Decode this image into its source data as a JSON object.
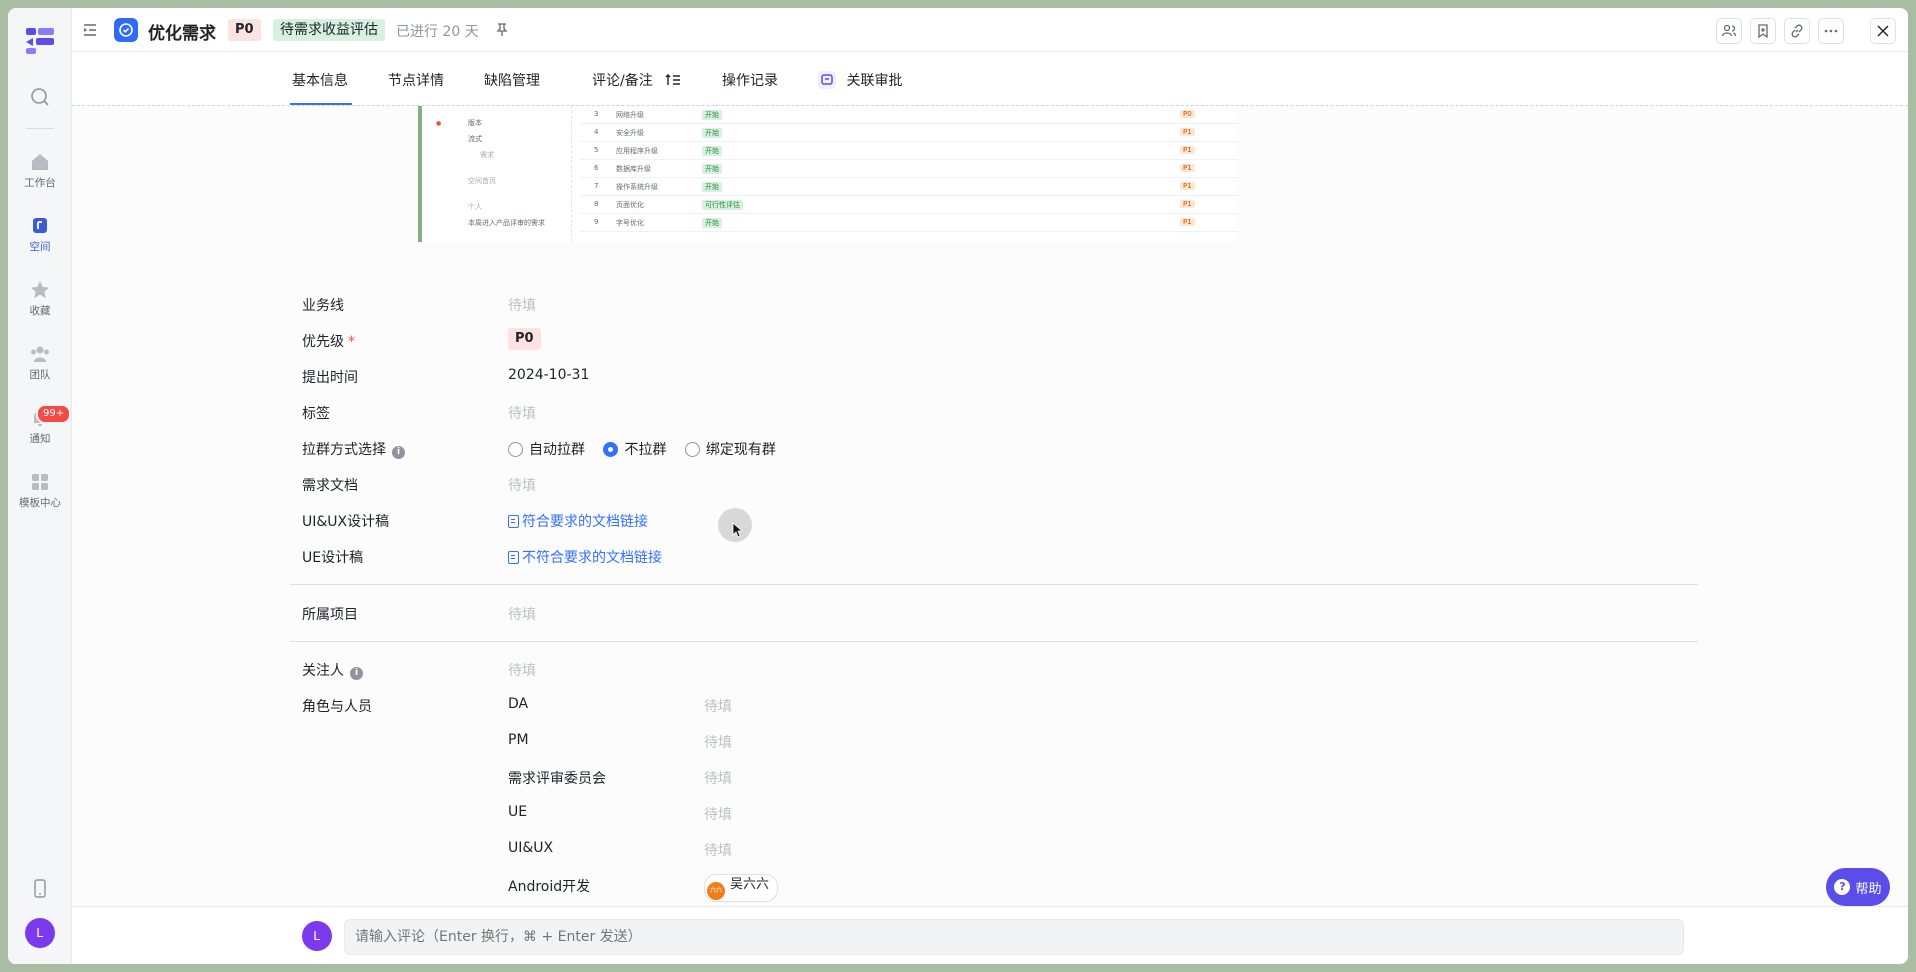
{
  "rail": {
    "items": [
      {
        "label": "工作台",
        "icon": "home-icon"
      },
      {
        "label": "空间",
        "icon": "space-icon"
      },
      {
        "label": "收藏",
        "icon": "star-icon"
      },
      {
        "label": "团队",
        "icon": "team-icon"
      },
      {
        "label": "通知",
        "icon": "bell-icon",
        "badge": "99+"
      },
      {
        "label": "模板中心",
        "icon": "template-icon"
      }
    ],
    "avatar": "L"
  },
  "header": {
    "title": "优化需求",
    "priority": "P0",
    "status": "待需求收益评估",
    "elapsed": "已进行 20 天"
  },
  "tabs": [
    {
      "label": "基本信息"
    },
    {
      "label": "节点详情"
    },
    {
      "label": "缺陷管理"
    },
    {
      "label": "评论/备注"
    },
    {
      "label": "操作记录"
    },
    {
      "label": "关联审批"
    }
  ],
  "embed": {
    "side": [
      "版本",
      "流式",
      "需求",
      "空间首页",
      "个人",
      "本周进入产品评审的需求"
    ],
    "rows": [
      {
        "no": "3",
        "name": "网络升级",
        "stage": "开始",
        "prio": "P0"
      },
      {
        "no": "4",
        "name": "安全升级",
        "stage": "开始",
        "prio": "P1"
      },
      {
        "no": "5",
        "name": "应用程序升级",
        "stage": "开始",
        "prio": "P1"
      },
      {
        "no": "6",
        "name": "数据库升级",
        "stage": "开始",
        "prio": "P1"
      },
      {
        "no": "7",
        "name": "操作系统升级",
        "stage": "开始",
        "prio": "P1"
      },
      {
        "no": "8",
        "name": "页面优化",
        "stage": "可行性评估",
        "prio": "P1"
      },
      {
        "no": "9",
        "name": "字号优化",
        "stage": "开始",
        "prio": "P1"
      }
    ]
  },
  "form": {
    "business_line": {
      "label": "业务线",
      "value": "待填"
    },
    "priority": {
      "label": "优先级",
      "required": "*",
      "value": "P0"
    },
    "created": {
      "label": "提出时间",
      "value": "2024-10-31"
    },
    "tags": {
      "label": "标签",
      "value": "待填"
    },
    "group": {
      "label": "拉群方式选择",
      "options": [
        "自动拉群",
        "不拉群",
        "绑定现有群"
      ],
      "selected": "不拉群"
    },
    "req_doc": {
      "label": "需求文档",
      "value": "待填"
    },
    "uiux": {
      "label": "UI&UX设计稿",
      "value": "符合要求的文档链接"
    },
    "ue": {
      "label": "UE设计稿",
      "value": "不符合要求的文档链接"
    },
    "project": {
      "label": "所属项目",
      "value": "待填"
    },
    "watchers": {
      "label": "关注人",
      "value": "待填"
    },
    "roles_label": "角色与人员",
    "roles": [
      {
        "role": "DA",
        "value": "待填"
      },
      {
        "role": "PM",
        "value": "待填"
      },
      {
        "role": "需求评审委员会",
        "value": "待填"
      },
      {
        "role": "UE",
        "value": "待填"
      },
      {
        "role": "UI&UX",
        "value": "待填"
      },
      {
        "role": "Android开发",
        "value": "吴六六"
      }
    ]
  },
  "comment": {
    "avatar": "L",
    "placeholder": "请输入评论（Enter 换行，⌘ + Enter 发送）"
  },
  "help": {
    "label": "帮助"
  }
}
